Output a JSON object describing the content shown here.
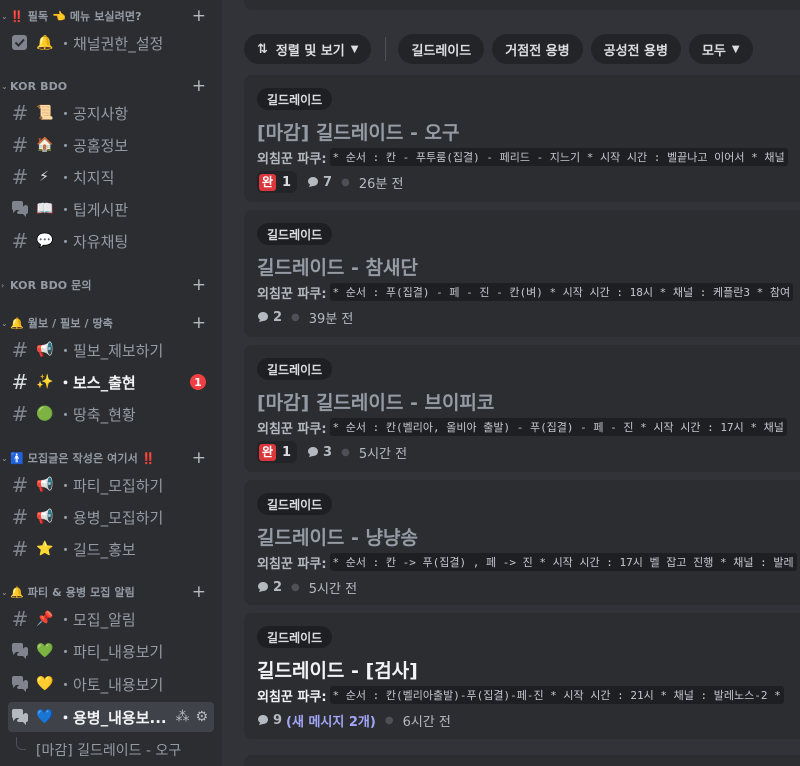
{
  "sidebar": {
    "categories": [
      {
        "label": "‼️ 필독 👈 메뉴 보실려면?"
      },
      {
        "label": "KOR BDO"
      },
      {
        "label": "KOR BDO 문의"
      },
      {
        "label": "🔔 월보 / 필보 / 땅축"
      },
      {
        "label": "🚹 모집글은 작성은 여기서 ‼️"
      },
      {
        "label": "🔔 파티 & 용병 모집 알림"
      }
    ],
    "channels": [
      {
        "emoji": "🔔",
        "name": "・채널권한_설정"
      },
      {
        "emoji": "📜",
        "name": "・공지사항"
      },
      {
        "emoji": "🏠",
        "name": "・공홈정보"
      },
      {
        "emoji": "⚡",
        "name": "・치지직"
      },
      {
        "emoji": "📖",
        "name": "・팁게시판"
      },
      {
        "emoji": "💬",
        "name": "・자유채팅"
      },
      {
        "emoji": "📢",
        "name": "・필보_제보하기"
      },
      {
        "emoji": "✨",
        "name": "・보스_출현",
        "badge": "1"
      },
      {
        "emoji": "🟢",
        "name": "・땅축_현황"
      },
      {
        "emoji": "📢",
        "name": "・파티_모집하기"
      },
      {
        "emoji": "📢",
        "name": "・용병_모집하기"
      },
      {
        "emoji": "⭐",
        "name": "・길드_홍보"
      },
      {
        "emoji": "📌",
        "name": "・모집_알림"
      },
      {
        "emoji": "💚",
        "name": "・파티_내용보기"
      },
      {
        "emoji": "💛",
        "name": "・아토_내용보기"
      },
      {
        "emoji": "💙",
        "name": "・용병_내용보..."
      }
    ],
    "active_thread": "[마감] 길드레이드 - 오구"
  },
  "toolbar": {
    "sort_label": "정렬 및 보기",
    "tags": [
      "길드레이드",
      "거점전 용병",
      "공성전 용병"
    ],
    "all_label": "모두"
  },
  "posts": [
    {
      "tag": "길드레이드",
      "title": "[마감] 길드레이드 - 오구",
      "author": "외침꾼 파쿠:",
      "snippet": "* 순서 : 칸 - 푸투룸(집결) - 페리드 - 지느기 * 시작 시간 : 벨끝나고 이어서 * 채널",
      "reaction_glyph": "완",
      "reaction_count": "1",
      "message_count": "7",
      "new_messages": "",
      "time": "26분 전"
    },
    {
      "tag": "길드레이드",
      "title": "길드레이드 - 참새단",
      "author": "외침꾼 파쿠:",
      "snippet": "* 순서 : 푸(집결) - 페 - 진 - 칸(벼) * 시작 시간 : 18시 * 채널 : 케플란3 * 참여",
      "reaction_glyph": "",
      "reaction_count": "",
      "message_count": "2",
      "new_messages": "",
      "time": "39분 전"
    },
    {
      "tag": "길드레이드",
      "title": "[마감] 길드레이드 - 브이피코",
      "author": "외침꾼 파쿠:",
      "snippet": "* 순서 : 칸(벨리아, 올비아 출발) - 푸(집결) - 페 - 진 * 시작 시간 : 17시 * 채널",
      "reaction_glyph": "완",
      "reaction_count": "1",
      "message_count": "3",
      "new_messages": "",
      "time": "5시간 전"
    },
    {
      "tag": "길드레이드",
      "title": "길드레이드 - 냥냥송",
      "author": "외침꾼 파쿠:",
      "snippet": "* 순서 : 칸 -> 푸(집결) , 페 -> 진 * 시작 시간 : 17시 벨 잡고 진행 * 채널 : 발레",
      "reaction_glyph": "",
      "reaction_count": "",
      "message_count": "2",
      "new_messages": "",
      "time": "5시간 전"
    },
    {
      "tag": "길드레이드",
      "title": "길드레이드 - [검사]",
      "author": "외침꾼 파쿠:",
      "snippet": "* 순서 : 칸(벨리아출발)-푸(집결)-페-진 * 시작 시간 : 21시 * 채널 : 발레노스-2 *",
      "reaction_glyph": "",
      "reaction_count": "",
      "message_count": "9",
      "new_messages": "(새 메시지 2개)",
      "time": "6시간 전"
    }
  ]
}
